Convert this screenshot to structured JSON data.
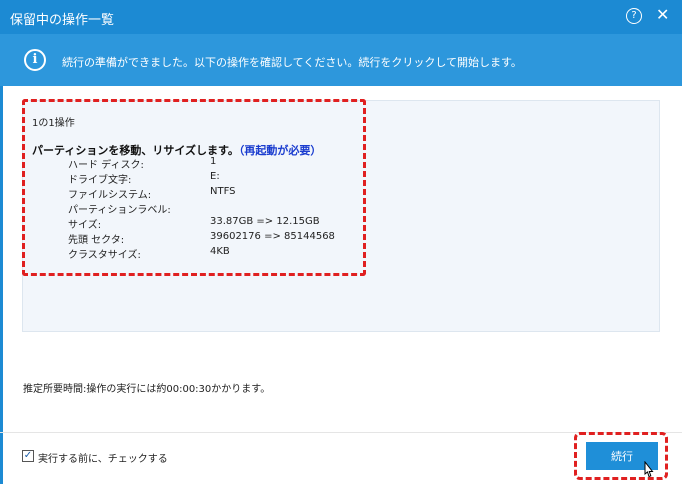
{
  "window": {
    "title": "保留中の操作一覧",
    "help_label": "?",
    "close_label": "✕"
  },
  "info": {
    "icon": "info-icon",
    "message": "続行の準備ができました。以下の操作を確認してください。続行をクリックして開始します。"
  },
  "operations": {
    "count_label": "1の1操作",
    "heading": "パーティションを移動、リサイズします。",
    "heading_note": "（再起動が必要）",
    "rows": [
      {
        "label": "ハード ディスク:",
        "value": "1"
      },
      {
        "label": "ドライブ文字:",
        "value": "E:"
      },
      {
        "label": "ファイルシステム:",
        "value": "NTFS"
      },
      {
        "label": "パーティションラベル:",
        "value": ""
      },
      {
        "label": "サイズ:",
        "value": "33.87GB => 12.15GB"
      },
      {
        "label": "先頭 セクタ:",
        "value": "39602176 => 85144568"
      },
      {
        "label": "クラスタサイズ:",
        "value": "4KB"
      }
    ]
  },
  "estimate": "推定所要時間:操作の実行には約00:00:30かかります。",
  "check_before": {
    "label": "実行する前に、チェックする",
    "checked": true
  },
  "continue_label": "続行",
  "colors": {
    "titlebar": "#1c8ad3",
    "info_bar": "#2d97dc",
    "button": "#1f8fd8",
    "highlight": "#e02020",
    "heading_note": "#1a3ccf"
  }
}
